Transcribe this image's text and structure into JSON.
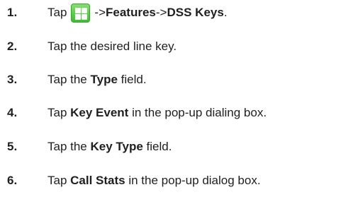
{
  "steps": [
    {
      "number": "1.",
      "pre": "Tap",
      "icon": "menu-grid-icon",
      "arrow1": "->",
      "b1": "Features",
      "arrow2": "->",
      "b2": "DSS Keys",
      "end": "."
    },
    {
      "number": "2.",
      "text": "Tap the desired line key."
    },
    {
      "number": "3.",
      "pre": "Tap the ",
      "bold": "Type",
      "post": " field."
    },
    {
      "number": "4.",
      "pre": "Tap ",
      "bold": "Key Event",
      "post": " in the pop-up dialing box."
    },
    {
      "number": "5.",
      "pre": "Tap the ",
      "bold": "Key Type",
      "post": " field."
    },
    {
      "number": "6.",
      "pre": "Tap ",
      "bold": "Call Stats",
      "post": " in the pop-up dialog box."
    }
  ],
  "colors": {
    "text": "#1f1f1f",
    "icon_green": "#3bbf2f"
  }
}
